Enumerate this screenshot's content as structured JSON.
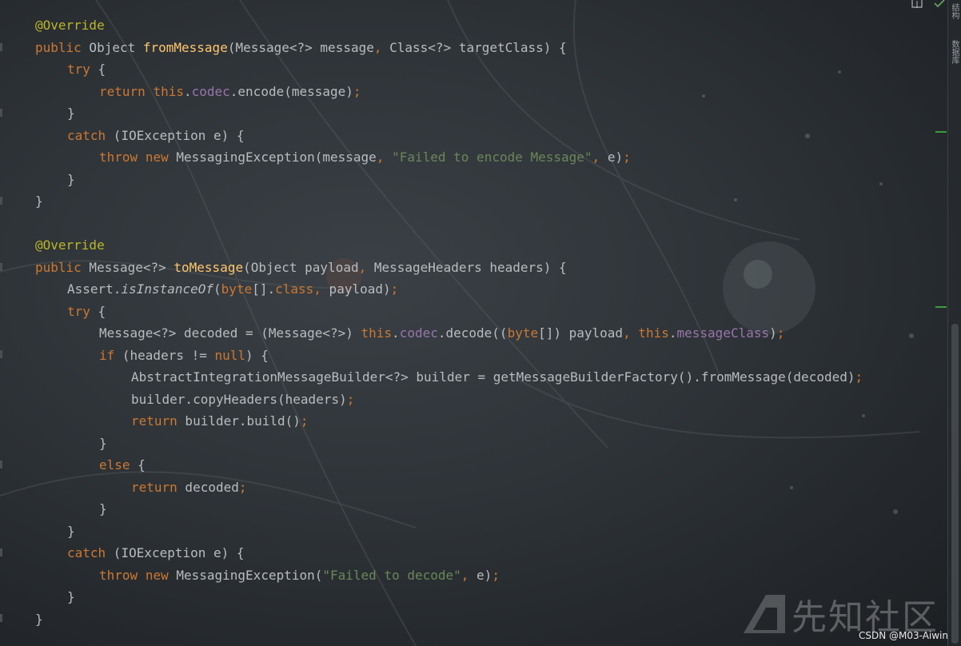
{
  "editor": {
    "lines": [
      [
        "@Override"
      ],
      [
        "public",
        " Object ",
        "fromMessage",
        "(Message<?> message",
        ",",
        " Class<?> targetClass) {"
      ],
      [
        "try",
        " {"
      ],
      [
        "return",
        " ",
        "this",
        ".",
        "codec",
        ".encode(message)",
        ";"
      ],
      [
        "}"
      ],
      [
        "catch",
        " (IOException e) {"
      ],
      [
        "throw",
        " ",
        "new",
        " MessagingException(message",
        ",",
        " ",
        "\"Failed to encode Message\"",
        ",",
        " e)",
        ";"
      ],
      [
        "}"
      ],
      [
        "}"
      ],
      [],
      [
        "@Override"
      ],
      [
        "public",
        " Message<?> ",
        "toMessage",
        "(Object payload",
        ",",
        " MessageHeaders headers) {"
      ],
      [
        "Assert.",
        "isInstanceOf",
        "(",
        "byte",
        "[].",
        "class",
        ",",
        " payload)",
        ";"
      ],
      [
        "try",
        " {"
      ],
      [
        "Message<?> decoded = (Message<?>) ",
        "this",
        ".",
        "codec",
        ".decode((",
        "byte",
        "[]) payload",
        ",",
        " ",
        "this",
        ".",
        "messageClass",
        ")",
        ";"
      ],
      [
        "if",
        " (headers != ",
        "null",
        ") {"
      ],
      [
        "AbstractIntegrationMessageBuilder<?> builder = getMessageBuilderFactory().fromMessage(decoded)",
        ";"
      ],
      [
        "builder.copyHeaders(headers)",
        ";"
      ],
      [
        "return",
        " builder.build()",
        ";"
      ],
      [
        "}"
      ],
      [
        "else",
        " {"
      ],
      [
        "return",
        " decoded",
        ";"
      ],
      [
        "}"
      ],
      [
        "}"
      ],
      [
        "catch",
        " (IOException e) {"
      ],
      [
        "throw",
        " ",
        "new",
        " MessagingException(",
        "\"Failed to decode\"",
        ",",
        " e)",
        ";"
      ],
      [
        "}"
      ],
      [
        "}"
      ]
    ]
  },
  "sidebar": {
    "tab_top": "结构",
    "tab_bottom": "数据库"
  },
  "watermark": {
    "text": "先知社区"
  },
  "credit": "CSDN @M03-Aiwin",
  "colors": {
    "keyword": "#cc7832",
    "annotation": "#bbb529",
    "method_decl": "#ffc66d",
    "field": "#9876aa",
    "string": "#6a8759",
    "plain": "#b9bcbf"
  }
}
